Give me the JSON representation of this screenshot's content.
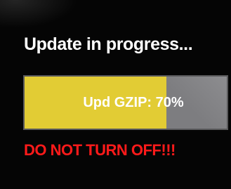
{
  "update": {
    "title": "Update in progress...",
    "progress_label": "Upd GZIP: 70%",
    "progress_fraction": 0.7,
    "warning": "DO NOT TURN OFF!!!"
  },
  "colors": {
    "background": "#050505",
    "title": "#ffffff",
    "progress_fill": "#e2cc34",
    "progress_track": "#7d7d80",
    "warning": "#ff1a1a"
  }
}
